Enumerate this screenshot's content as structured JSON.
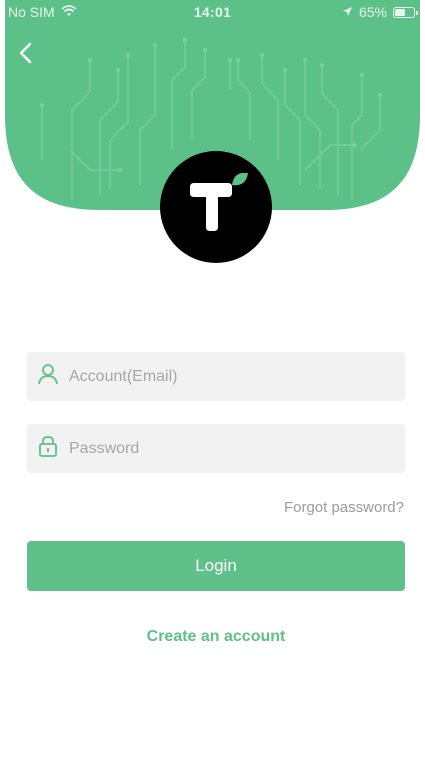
{
  "status_bar": {
    "carrier": "No SIM",
    "time": "14:01",
    "battery": "65%",
    "battery_level": 0.65,
    "icons": [
      "wifi-icon",
      "location-arrow-icon",
      "battery-icon"
    ]
  },
  "header": {
    "icons": [
      "back-chevron-icon",
      "app-logo-icon"
    ]
  },
  "form": {
    "account": {
      "placeholder": "Account(Email)",
      "value": "",
      "icon": "user-icon"
    },
    "password": {
      "placeholder": "Password",
      "value": "",
      "icon": "lock-icon"
    },
    "forgot_label": "Forgot password?",
    "login_label": "Login",
    "create_label": "Create an account"
  },
  "colors": {
    "brand_green": "#5fc08a",
    "header_green": "#5cc089",
    "field_bg": "#f2f2f2"
  }
}
